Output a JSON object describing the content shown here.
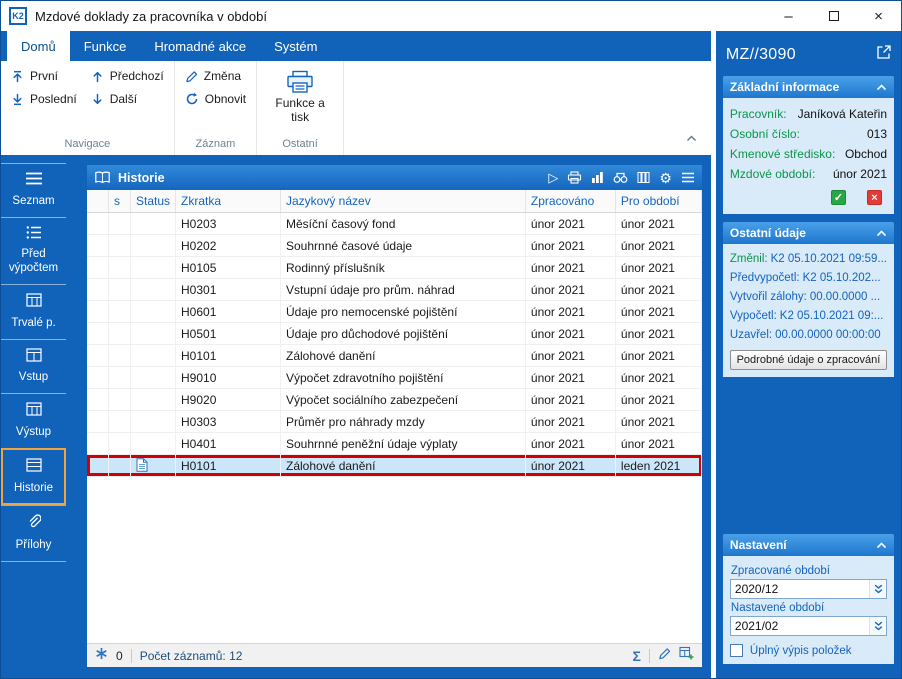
{
  "colors": {
    "primary_blue": "#1163BA",
    "accent_blue": "#1464BE",
    "label_green": "#0A9648",
    "selected_row_bg": "#CBE6F9",
    "selected_row_border": "#D40000",
    "active_item_border": "#F2A33C"
  },
  "icons": {
    "run": "▷",
    "gear": "⚙",
    "sum": "Σ",
    "check": "✓",
    "cross": "×",
    "minimize": "–",
    "close": "×"
  },
  "titlebar": {
    "logo": "K2",
    "title": "Mzdové doklady za pracovníka v období"
  },
  "ribbon": {
    "tabs": [
      {
        "label": "Domů",
        "active": true
      },
      {
        "label": "Funkce",
        "active": false
      },
      {
        "label": "Hromadné akce",
        "active": false
      },
      {
        "label": "Systém",
        "active": false
      }
    ],
    "nav": {
      "first": "První",
      "last": "Poslední",
      "prev": "Předchozí",
      "next": "Další"
    },
    "record": {
      "change": "Změna",
      "refresh": "Obnovit"
    },
    "other": {
      "print": "Funkce a tisk"
    },
    "group_labels": {
      "nav": "Navigace",
      "record": "Záznam",
      "other": "Ostatní"
    }
  },
  "sidebar": {
    "items": [
      {
        "label": "Seznam"
      },
      {
        "label": "Před výpočtem"
      },
      {
        "label": "Trvalé p."
      },
      {
        "label": "Vstup"
      },
      {
        "label": "Výstup"
      },
      {
        "label": "Historie",
        "active": true
      },
      {
        "label": "Přílohy"
      }
    ]
  },
  "historie": {
    "title": "Historie",
    "columns": {
      "s": "s",
      "status": "Status",
      "zkratka": "Zkratka",
      "nazev": "Jazykový název",
      "zpracovano": "Zpracováno",
      "obdobi": "Pro období"
    },
    "rows": [
      {
        "zkratka": "H0203",
        "nazev": "Měsíční časový fond",
        "zpracovano": "únor 2021",
        "obdobi": "únor 2021"
      },
      {
        "zkratka": "H0202",
        "nazev": "Souhrnné časové údaje",
        "zpracovano": "únor 2021",
        "obdobi": "únor 2021"
      },
      {
        "zkratka": "H0105",
        "nazev": "Rodinný příslušník",
        "zpracovano": "únor 2021",
        "obdobi": "únor 2021"
      },
      {
        "zkratka": "H0301",
        "nazev": "Vstupní údaje pro prům. náhrad",
        "zpracovano": "únor 2021",
        "obdobi": "únor 2021"
      },
      {
        "zkratka": "H0601",
        "nazev": "Údaje pro nemocenské pojištění",
        "zpracovano": "únor 2021",
        "obdobi": "únor 2021"
      },
      {
        "zkratka": "H0501",
        "nazev": "Údaje pro důchodové pojištění",
        "zpracovano": "únor 2021",
        "obdobi": "únor 2021"
      },
      {
        "zkratka": "H0101",
        "nazev": "Zálohové danění",
        "zpracovano": "únor 2021",
        "obdobi": "únor 2021"
      },
      {
        "zkratka": "H9010",
        "nazev": "Výpočet zdravotního pojištění",
        "zpracovano": "únor 2021",
        "obdobi": "únor 2021"
      },
      {
        "zkratka": "H9020",
        "nazev": "Výpočet sociálního zabezpečení",
        "zpracovano": "únor 2021",
        "obdobi": "únor 2021"
      },
      {
        "zkratka": "H0303",
        "nazev": "Průměr pro náhrady mzdy",
        "zpracovano": "únor 2021",
        "obdobi": "únor 2021"
      },
      {
        "zkratka": "H0401",
        "nazev": "Souhrnné peněžní údaje výplaty",
        "zpracovano": "únor 2021",
        "obdobi": "únor 2021"
      },
      {
        "zkratka": "H0101",
        "nazev": "Zálohové danění",
        "zpracovano": "únor 2021",
        "obdobi": "leden 2021",
        "selected": true
      }
    ],
    "footer": {
      "badge": "0",
      "count": "Počet záznamů: 12"
    }
  },
  "right_panel": {
    "title": "MZ//3090",
    "basic": {
      "header": "Základní informace",
      "rows": [
        {
          "label": "Pracovník:",
          "value": "Janíková Kateřin"
        },
        {
          "label": "Osobní číslo:",
          "value": "013"
        },
        {
          "label": "Kmenové středisko:",
          "value": "Obchod"
        },
        {
          "label": "Mzdové období:",
          "value": "únor 2021"
        }
      ]
    },
    "other": {
      "header": "Ostatní údaje",
      "rows": [
        {
          "label": "Změnil:",
          "value": "K2 05.10.2021 09:59..."
        },
        {
          "label": "Předvypočetl:",
          "value": "K2 05.10.202..."
        },
        {
          "label": "Vytvořil zálohy:",
          "value": "00.00.0000 ..."
        },
        {
          "label": "Vypočetl:",
          "value": "K2 05.10.2021 09:..."
        },
        {
          "label": "Uzavřel:",
          "value": "00.00.0000 00:00:00"
        }
      ],
      "button": "Podrobné údaje o zpracování"
    },
    "settings": {
      "header": "Nastavení",
      "processed_label": "Zpracované období",
      "processed_value": "2020/12",
      "set_label": "Nastavené období",
      "set_value": "2021/02",
      "checkbox_label": "Úplný výpis položek"
    }
  }
}
